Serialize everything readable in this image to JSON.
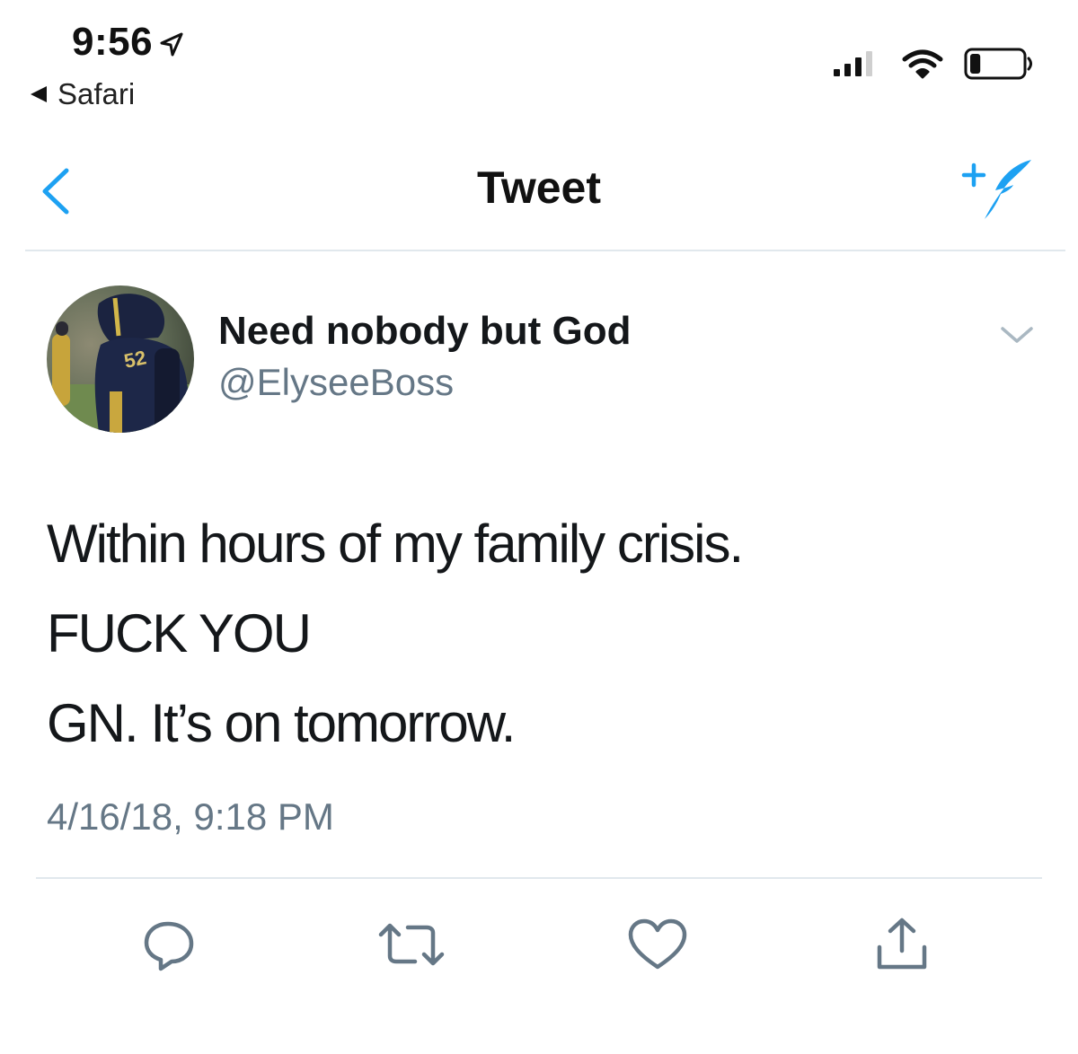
{
  "status_bar": {
    "time": "9:56",
    "back_app": "Safari",
    "location_icon": "location-arrow-icon",
    "signal_icon": "cellular-signal-icon",
    "wifi_icon": "wifi-icon",
    "battery_icon": "battery-icon",
    "battery_level": 0.2
  },
  "nav": {
    "title": "Tweet",
    "back_icon": "chevron-left-icon",
    "compose_icon": "compose-tweet-icon"
  },
  "tweet": {
    "author": {
      "name": "Need nobody but God",
      "handle": "@ElyseeBoss",
      "avatar_icon": "avatar-photo",
      "avatar_jersey": "52"
    },
    "lines": [
      "Within hours of my family crisis.",
      "FUCK YOU",
      "GN. It’s on tomorrow."
    ],
    "timestamp": "4/16/18, 9:18 PM",
    "menu_icon": "chevron-down-icon"
  },
  "actions": [
    {
      "name": "reply",
      "icon": "reply-icon"
    },
    {
      "name": "retweet",
      "icon": "retweet-icon"
    },
    {
      "name": "like",
      "icon": "heart-icon"
    },
    {
      "name": "share",
      "icon": "share-icon"
    }
  ],
  "colors": {
    "accent": "#1da1f2",
    "text_primary": "#14171a",
    "text_secondary": "#657786",
    "divider": "#e1e8ed"
  }
}
